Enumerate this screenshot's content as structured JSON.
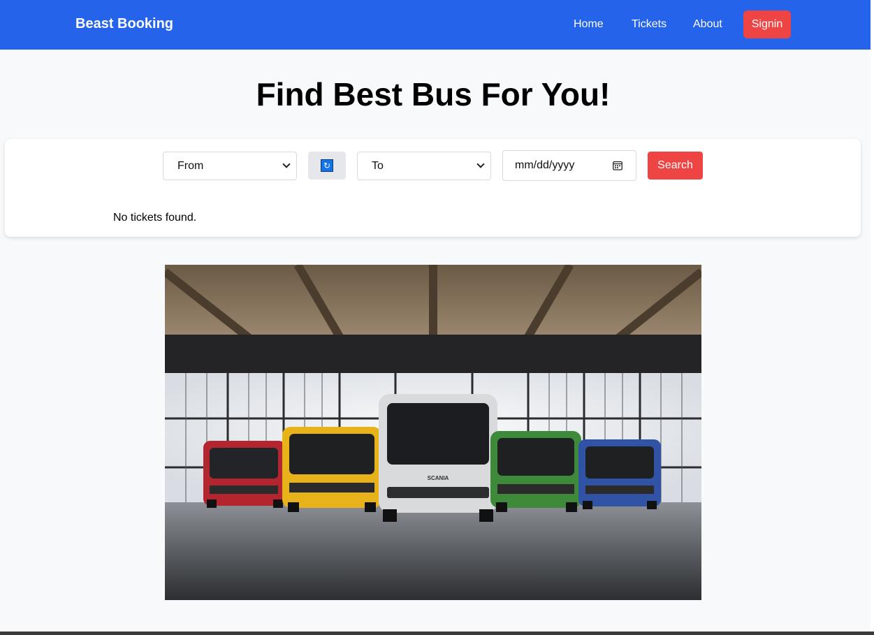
{
  "navbar": {
    "brand": "Beast Booking",
    "links": [
      {
        "label": "Home"
      },
      {
        "label": "Tickets"
      },
      {
        "label": "About"
      }
    ],
    "signin_label": "Signin",
    "bg_color": "#2563eb",
    "signin_color": "#ef4444"
  },
  "main": {
    "title": "Find Best Bus For You!"
  },
  "search": {
    "from_selected": "From",
    "to_selected": "To",
    "date_placeholder": "mm/dd/yyyy",
    "swap_icon": "swap-icon",
    "calendar_icon": "calendar-icon",
    "search_label": "Search",
    "search_color": "#ef4444"
  },
  "results": {
    "empty_message": "No tickets found."
  },
  "hero": {
    "bus_colors": [
      "#b3262f",
      "#e8b21a",
      "#d8dadc",
      "#3f8a3a",
      "#3153a6"
    ],
    "bus_brand_text": "SCANIA"
  }
}
